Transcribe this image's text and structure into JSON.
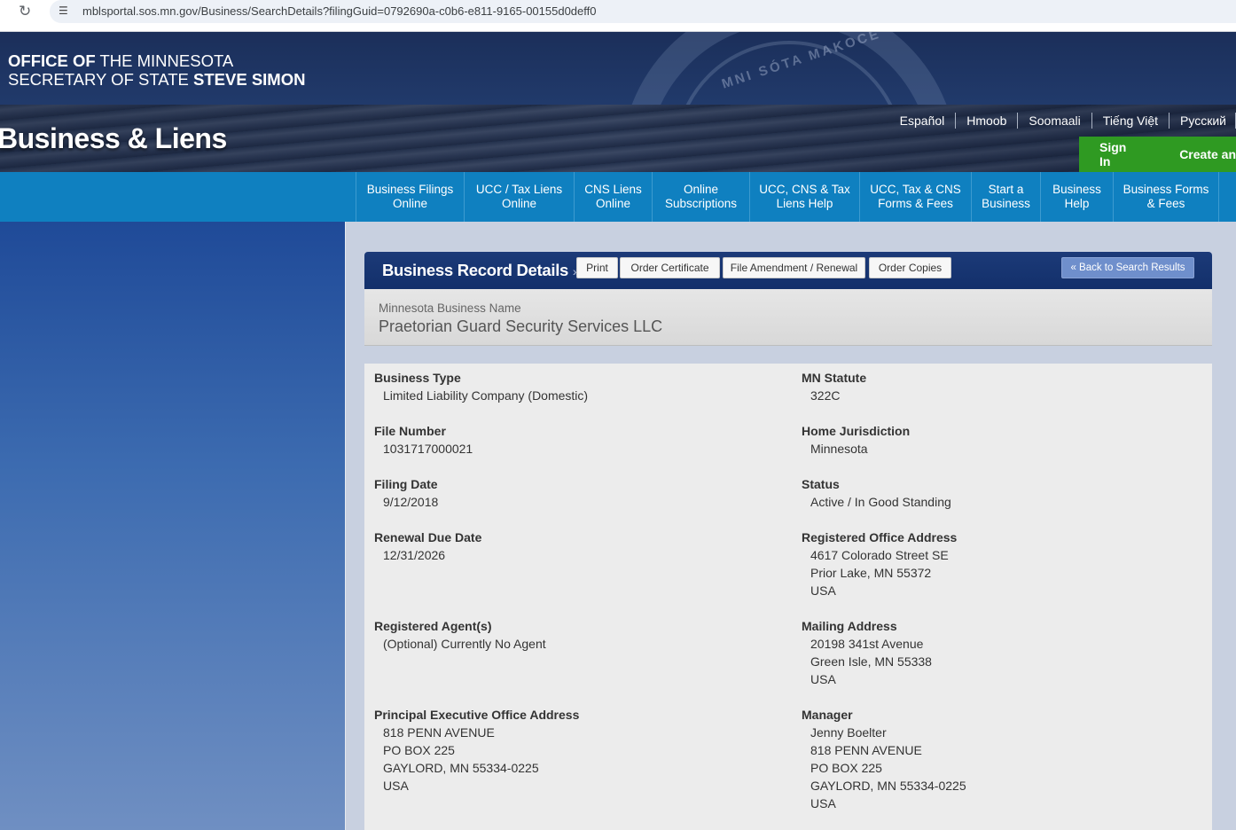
{
  "browser": {
    "url": "mblsportal.sos.mn.gov/Business/SearchDetails?filingGuid=0792690a-c0b6-e811-9165-00155d0deff0"
  },
  "header": {
    "office_line1_bold": "OFFICE OF",
    "office_line1_rest": " THE MINNESOTA",
    "office_line2_rest": "SECRETARY OF STATE ",
    "office_line2_bold": "STEVE SIMON",
    "seal_text": "MNI SÓTA MAKOCE",
    "site_title": "Business & Liens",
    "languages": [
      "Español",
      "Hmoob",
      "Soomaali",
      "Tiếng Việt",
      "Русский"
    ],
    "sign_in": "Sign In",
    "create_account": "Create an"
  },
  "nav": [
    {
      "line1": "Business Filings",
      "line2": "Online"
    },
    {
      "line1": "UCC / Tax Liens",
      "line2": "Online"
    },
    {
      "line1": "CNS Liens",
      "line2": "Online"
    },
    {
      "line1": "Online",
      "line2": "Subscriptions"
    },
    {
      "line1": "UCC, CNS & Tax",
      "line2": "Liens Help"
    },
    {
      "line1": "UCC, Tax & CNS",
      "line2": "Forms & Fees"
    },
    {
      "line1": "Start a",
      "line2": "Business"
    },
    {
      "line1": "Business",
      "line2": "Help"
    },
    {
      "line1": "Business Forms",
      "line2": "& Fees"
    }
  ],
  "record": {
    "title": "Business Record Details",
    "title_suffix": "»",
    "buttons": {
      "print": "Print",
      "order_certificate": "Order Certificate",
      "file_amendment": "File Amendment / Renewal",
      "order_copies": "Order Copies",
      "back": "« Back to Search Results"
    },
    "name_label": "Minnesota Business Name",
    "name_value": "Praetorian Guard Security Services LLC"
  },
  "fields": {
    "business_type": {
      "label": "Business Type",
      "lines": [
        "Limited Liability Company (Domestic)"
      ]
    },
    "mn_statute": {
      "label": "MN Statute",
      "lines": [
        "322C"
      ]
    },
    "file_number": {
      "label": "File Number",
      "lines": [
        "1031717000021"
      ]
    },
    "home_jurisdiction": {
      "label": "Home Jurisdiction",
      "lines": [
        "Minnesota"
      ]
    },
    "filing_date": {
      "label": "Filing Date",
      "lines": [
        "9/12/2018"
      ]
    },
    "status": {
      "label": "Status",
      "lines": [
        "Active / In Good Standing"
      ]
    },
    "renewal_due_date": {
      "label": "Renewal Due Date",
      "lines": [
        "12/31/2026"
      ]
    },
    "registered_office_address": {
      "label": "Registered Office Address",
      "lines": [
        "4617 Colorado Street SE",
        "Prior Lake, MN 55372",
        "USA"
      ]
    },
    "registered_agents": {
      "label": "Registered Agent(s)",
      "lines": [
        "(Optional) Currently No Agent"
      ]
    },
    "mailing_address": {
      "label": "Mailing Address",
      "lines": [
        "20198 341st Avenue",
        "Green Isle, MN 55338",
        "USA"
      ]
    },
    "principal_executive_office": {
      "label": "Principal Executive Office Address",
      "lines": [
        "818 PENN AVENUE",
        "PO BOX 225",
        "GAYLORD, MN 55334-0225",
        "USA"
      ]
    },
    "manager": {
      "label": "Manager",
      "lines": [
        "Jenny Boelter",
        "818 PENN AVENUE",
        "PO BOX 225",
        "GAYLORD, MN 55334-0225",
        "USA"
      ]
    }
  }
}
